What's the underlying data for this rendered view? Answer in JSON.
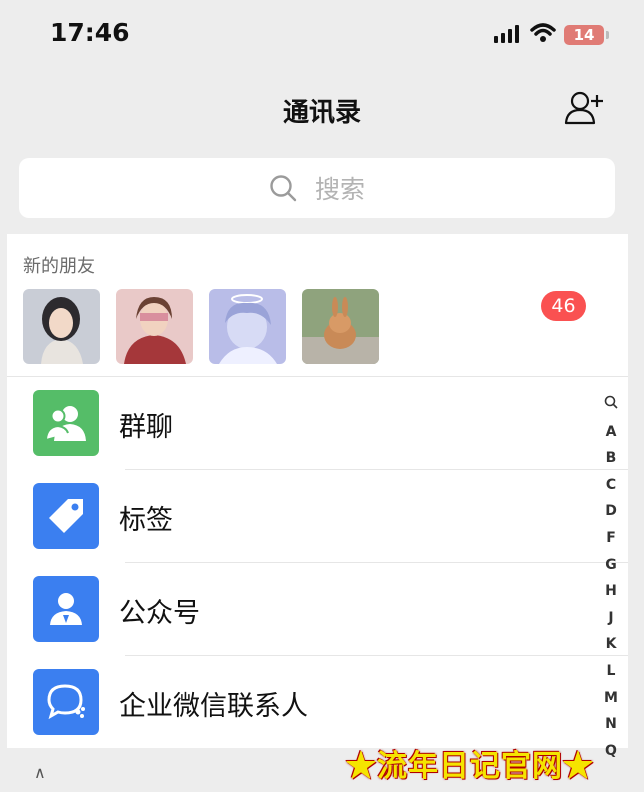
{
  "status_bar": {
    "time": "17:46",
    "battery": "14"
  },
  "nav": {
    "title": "通讯录",
    "add_friend_icon": "person-add-icon"
  },
  "search": {
    "placeholder": "搜索",
    "icon": "search-icon"
  },
  "new_friends": {
    "label": "新的朋友",
    "badge_count": "46"
  },
  "entries": [
    {
      "label": "群聊",
      "icon": "group-chat-icon",
      "color": "#55bd68"
    },
    {
      "label": "标签",
      "icon": "tag-icon",
      "color": "#3b7ff0"
    },
    {
      "label": "公众号",
      "icon": "official-account-icon",
      "color": "#3b7ff0"
    },
    {
      "label": "企业微信联系人",
      "icon": "work-chat-icon",
      "color": "#3b7ff0"
    }
  ],
  "index_letters": [
    "A",
    "B",
    "C",
    "D",
    "F",
    "G",
    "H",
    "J",
    "K",
    "L",
    "M",
    "N",
    "Q"
  ],
  "footer": {
    "caret": "∧"
  },
  "watermark": "★流年日记官网★"
}
